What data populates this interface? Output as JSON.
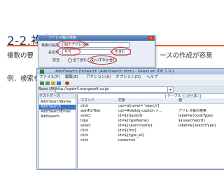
{
  "slide": {
    "title": "2-2.複数条件のテスト",
    "body_line1": "複数の要",
    "body_line1_tail": "ースの作成が容易",
    "body_line2": "例．検索を行"
  },
  "dialog": {
    "title": "アドレス帳の検索",
    "close_label": "x",
    "field1_label": "検索の名前:",
    "field1_value": "個人アドレス帳",
    "field2_label": "名前が",
    "field2_value": "ちち",
    "field2_operator": "を含む",
    "radio_label": "該当",
    "radio_opt1": "全て含む",
    "radio_opt2": "いずれか含む",
    "radio_selected": 2
  },
  "window": {
    "title": "AddrSearch (toSearch (AddrSearch.html) - Selenium IDE 1.0.2",
    "menu": [
      "ファイル(F)",
      "編集(E)",
      "アクション(A)",
      "オプション(O)",
      "ヘルプ"
    ],
    "base_url_label": "Base URL",
    "base_url_value": "http://sgate4.orangesoft.co.jp/",
    "testcases_header": "テストケース",
    "testcases": [
      "AddrSearchName",
      "AddrSearch",
      "AddrSearchEmail",
      "AddSearch"
    ],
    "selected_testcase": 1,
    "tab_table": "テーブル",
    "tab_source": "ソース",
    "columns": [
      "コマンド",
      "対象",
      "値"
    ],
    "rows": [
      [
        "click",
        "css=a[name= 'search']",
        ""
      ],
      [
        "waitForText",
        "css=#dialog-caption >...",
        "アドレス帳の検索"
      ],
      [
        "select",
        "id=${bookId}",
        "label=${bookType}"
      ],
      [
        "type",
        "id=${typeName}",
        "${searchword}"
      ],
      [
        "select",
        "id=${searchname}",
        "label=${searchType}"
      ],
      [
        "click",
        "id=${fno}",
        ""
      ],
      [
        "click",
        "id=${type_all}",
        ""
      ],
      [
        "click",
        "name=ok",
        ""
      ]
    ]
  },
  "colors": {
    "accent": "#f05a28",
    "title_text": "#18374f",
    "highlight": "#e01e1e",
    "selection": "#3d74c6"
  }
}
